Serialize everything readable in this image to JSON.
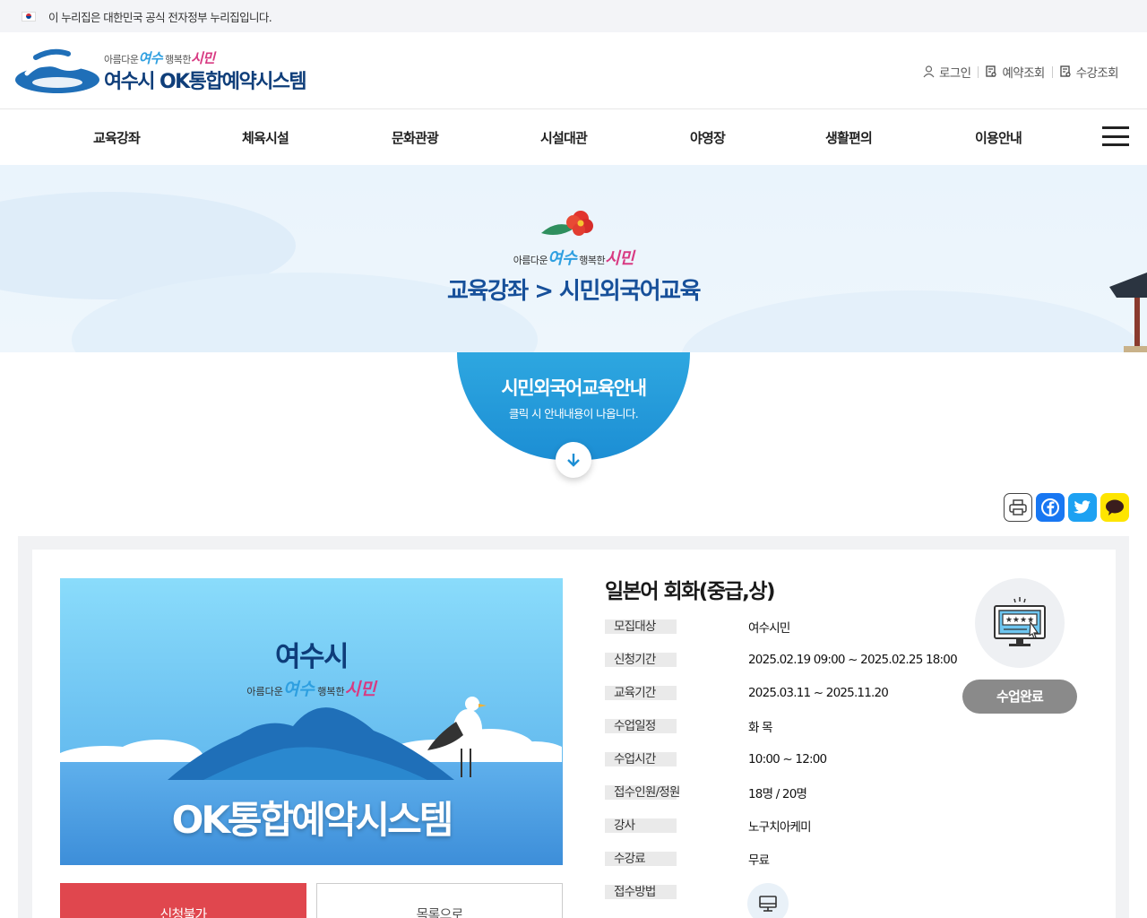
{
  "gov_banner": {
    "text": "이 누리집은 대한민국 공식 전자정부 누리집입니다."
  },
  "header": {
    "logo_slogan": {
      "pre": "아름다운",
      "yeosu": "여수",
      "mid": "행복한",
      "citizen": "시민"
    },
    "logo_title": "여수시 OK통합예약시스템",
    "util": {
      "login": "로그인",
      "reservation": "예약조회",
      "course": "수강조회"
    }
  },
  "nav": {
    "items": [
      {
        "label": "교육강좌"
      },
      {
        "label": "체육시설"
      },
      {
        "label": "문화관광"
      },
      {
        "label": "시설대관"
      },
      {
        "label": "야영장"
      },
      {
        "label": "생활편의"
      },
      {
        "label": "이용안내"
      }
    ]
  },
  "hero": {
    "slogan": {
      "pre": "아름다운",
      "yeosu": "여수",
      "mid": "행복한",
      "citizen": "시민"
    },
    "title": "교육강좌 > 시민외국어교육"
  },
  "guide": {
    "title": "시민외국어교육안내",
    "subtitle": "클릭 시 안내내용이 나옵니다."
  },
  "thumbnail": {
    "brand": "여수시",
    "slogan": {
      "pre": "아름다운",
      "yeosu": "여수",
      "mid": "행복한",
      "citizen": "시민"
    },
    "title": "OK통합예약시스템"
  },
  "buttons": {
    "apply": "신청불가",
    "list": "목록으로"
  },
  "course": {
    "title": "일본어 회화(중급,상)",
    "info": [
      {
        "label": "모집대상",
        "value": "여수시민"
      },
      {
        "label": "신청기간",
        "value": "2025.02.19 09:00 ~ 2025.02.25 18:00"
      },
      {
        "label": "교육기간",
        "value": "2025.03.11 ~ 2025.11.20"
      },
      {
        "label": "수업일정",
        "value": "화 목"
      },
      {
        "label": "수업시간",
        "value": "10:00 ~ 12:00"
      },
      {
        "label": "접수인원/정원",
        "value": "18명 / 20명"
      },
      {
        "label": "강사",
        "value": "노구치아케미"
      },
      {
        "label": "수강료",
        "value": "무료"
      },
      {
        "label": "접수방법",
        "value": ""
      }
    ],
    "status": "수업완료"
  },
  "colors": {
    "primary_blue": "#1c8ed4",
    "apply_red": "#e0474e",
    "status_gray": "#8a8a8a",
    "title_navy": "#17509a"
  }
}
